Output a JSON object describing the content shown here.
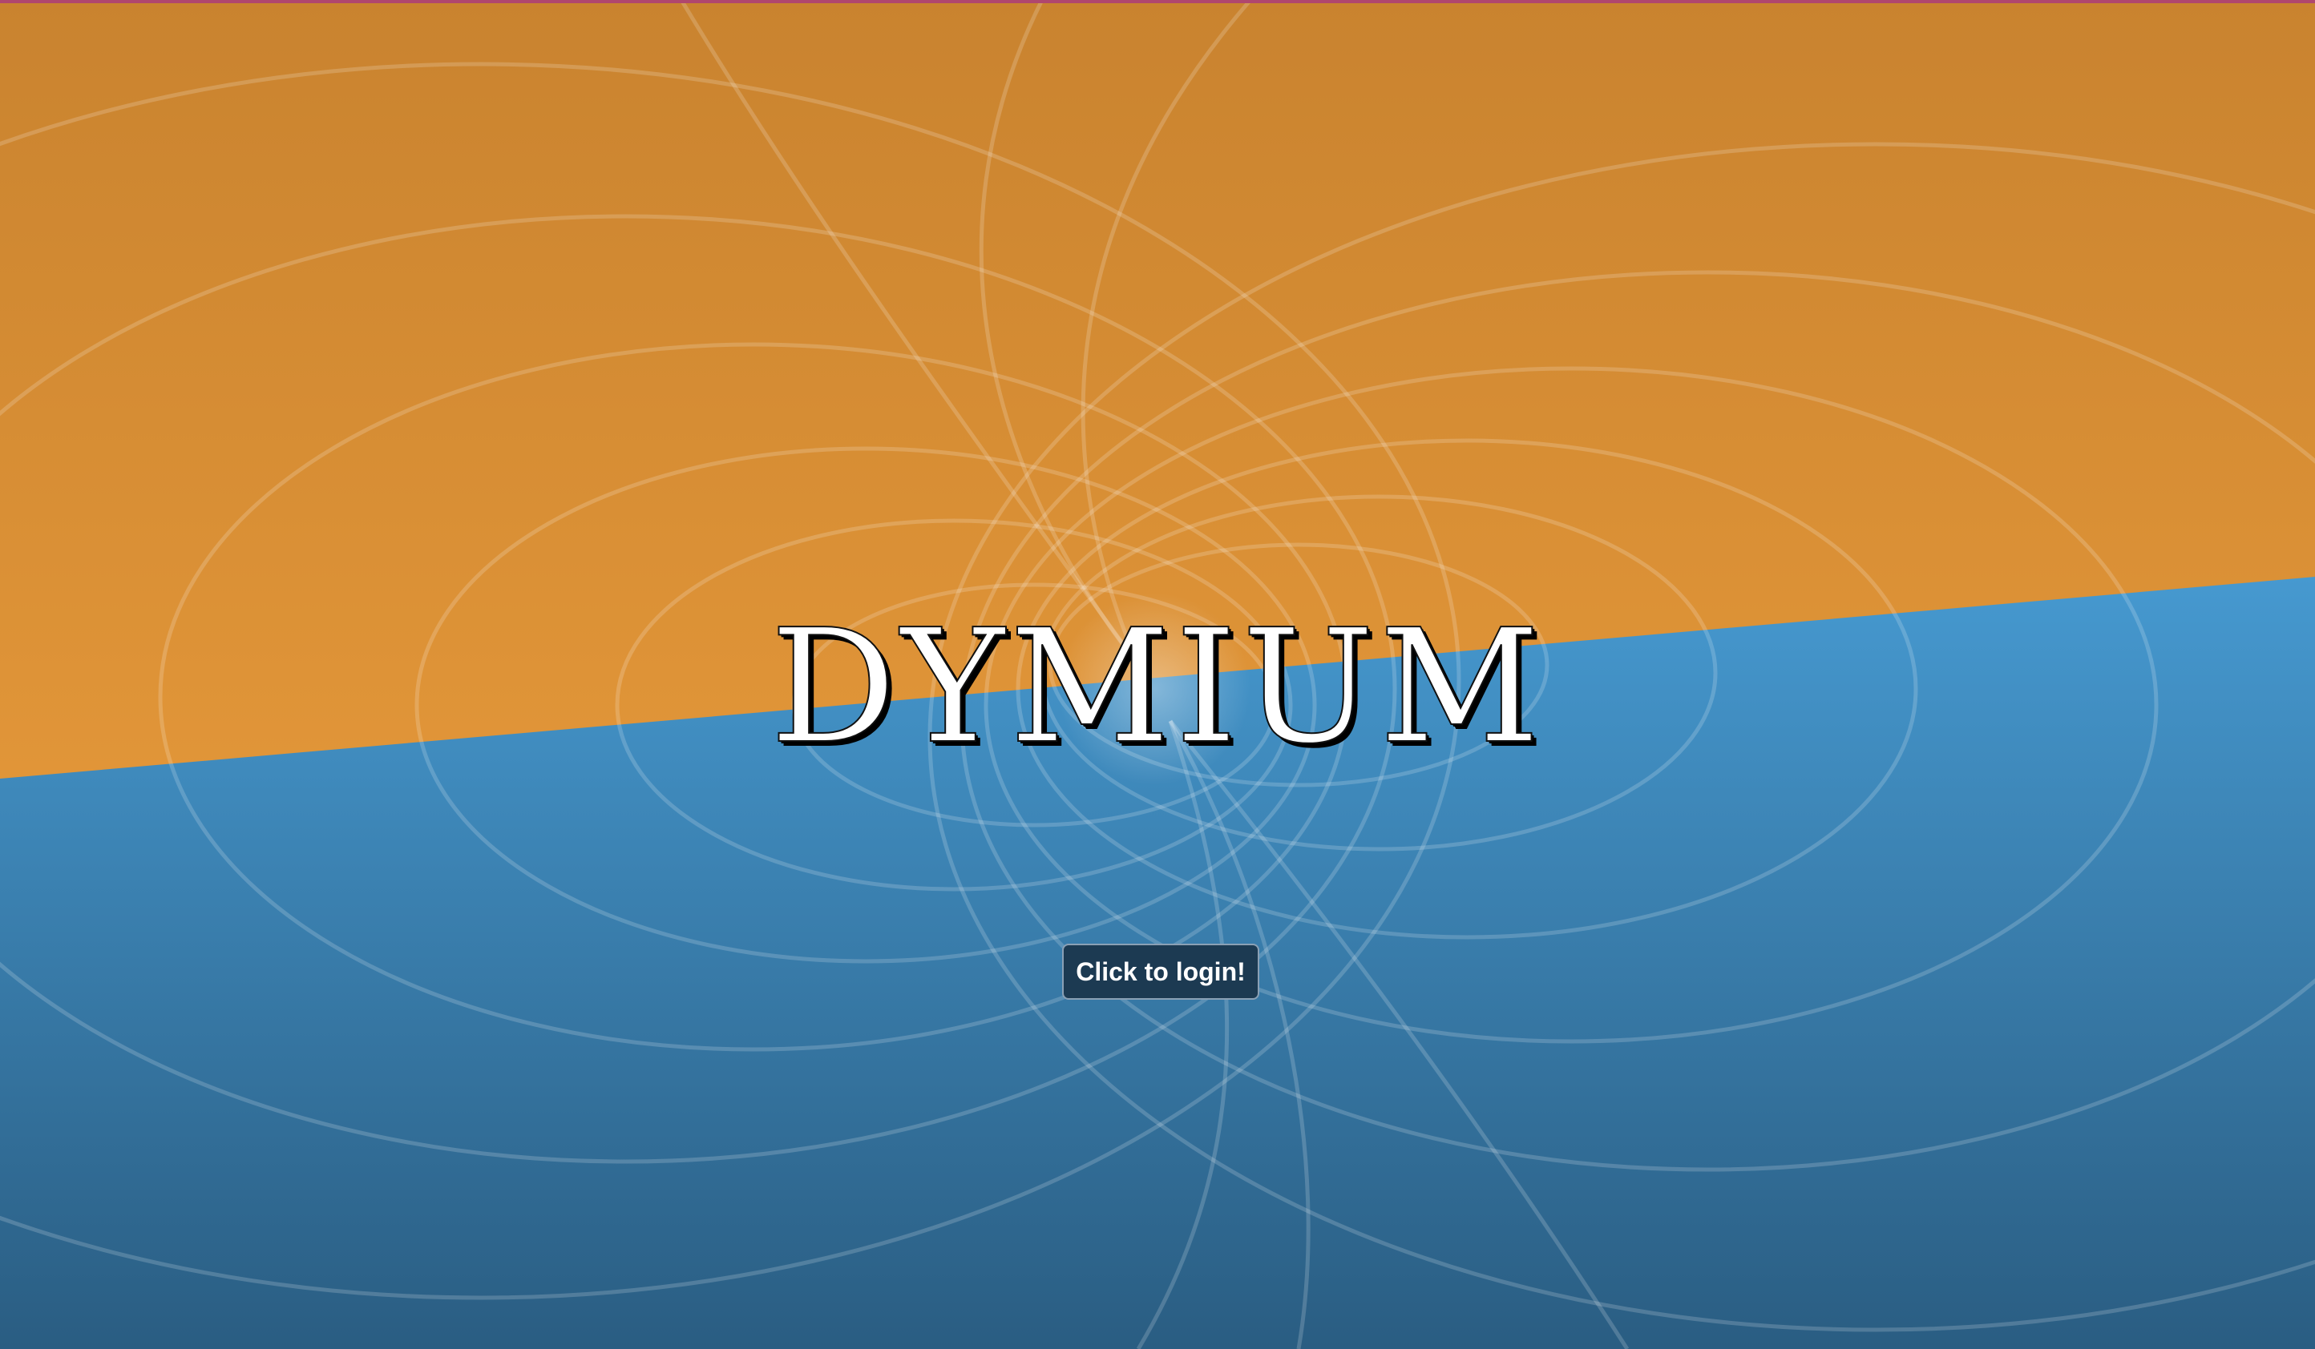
{
  "brand": {
    "name": "DYMIUM"
  },
  "login": {
    "button_label": "Click to login!"
  },
  "colors": {
    "top_accent": "#b0476e",
    "orange_top": "#c9832f",
    "orange_bottom": "#f3a33f",
    "blue_top": "#4699d0",
    "blue_bottom": "#2a5d82",
    "button_bg": "#1c3a52",
    "field_lines": "#ffffff"
  }
}
